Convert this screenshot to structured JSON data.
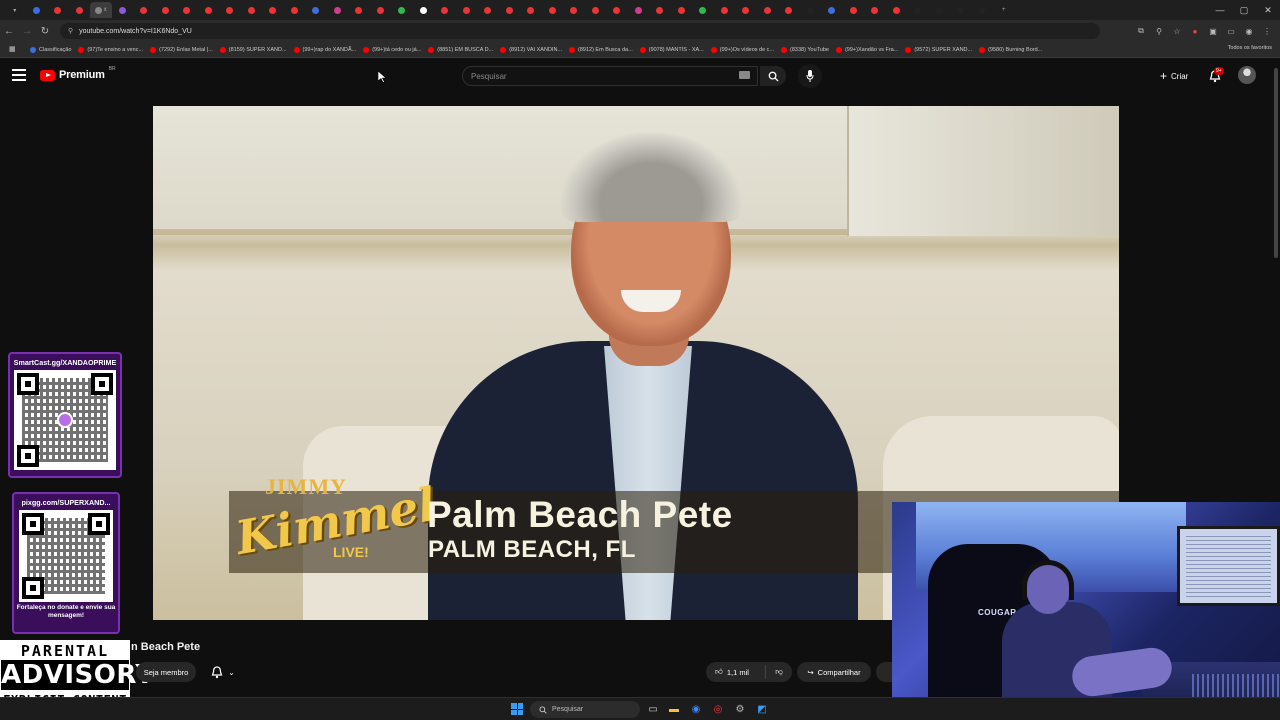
{
  "browser": {
    "url": "youtube.com/watch?v=I1K6Ndo_VU",
    "tab_count_marker": "x",
    "window_controls": [
      "—",
      "▢",
      "✕"
    ],
    "bookmarks": [
      "Classificação",
      "(97)Te ensino a venc...",
      "(7292) Enlas Metal |...",
      "(8159) SUPER XAND...",
      "(99+)rap do XANDÃ...",
      "(99+)tá cedo ou já...",
      "(8851) EM BUSCA D...",
      "(8912) VAI XANDIN...",
      "(8912) Em Busca da...",
      "(9078) MANTIS - XA...",
      "(99+)Os vídeos de c...",
      "(8338) YouTube",
      "(99+)Xandão vs Fra...",
      "(9572) SUPER XAND...",
      "(9580) Burning Bord..."
    ],
    "all_bookmarks_label": "Todos os favoritos"
  },
  "youtube": {
    "logo_text": "Premium",
    "country_code": "BR",
    "search_placeholder": "Pesquisar",
    "create_label": "Criar",
    "notifications_badge": "9+"
  },
  "video": {
    "show_logo_top": "JIMMY",
    "show_logo_main": "Kimmel",
    "show_logo_bottom": "LIVE!",
    "lower_third_name": "Palm Beach Pete",
    "lower_third_location": "PALM BEACH, FL",
    "title_visible": "n Beach Pete"
  },
  "actions": {
    "member_label": "Seja membro",
    "likes": "1,1 mil",
    "share_label": "Compartilhar"
  },
  "overlays": {
    "qr1_title": "SmartCast.gg/XANDAOPRIME",
    "qr2_title": "pixgg.com/SUPERXAND...",
    "qr2_footer": "Fortaleça no donate e envie sua mensagem!",
    "advisory_top": "PARENTAL",
    "advisory_mid": "ADVISORY",
    "advisory_bottom": "EXPLICIT CONTENT",
    "webcam_chair_brand": "COUGAR"
  },
  "taskbar": {
    "search_label": "Pesquisar"
  },
  "colors": {
    "yt_red": "#ff0000",
    "qr_card_bg": "#3a0e5a",
    "kimmel_gold": "#f2c84b"
  }
}
